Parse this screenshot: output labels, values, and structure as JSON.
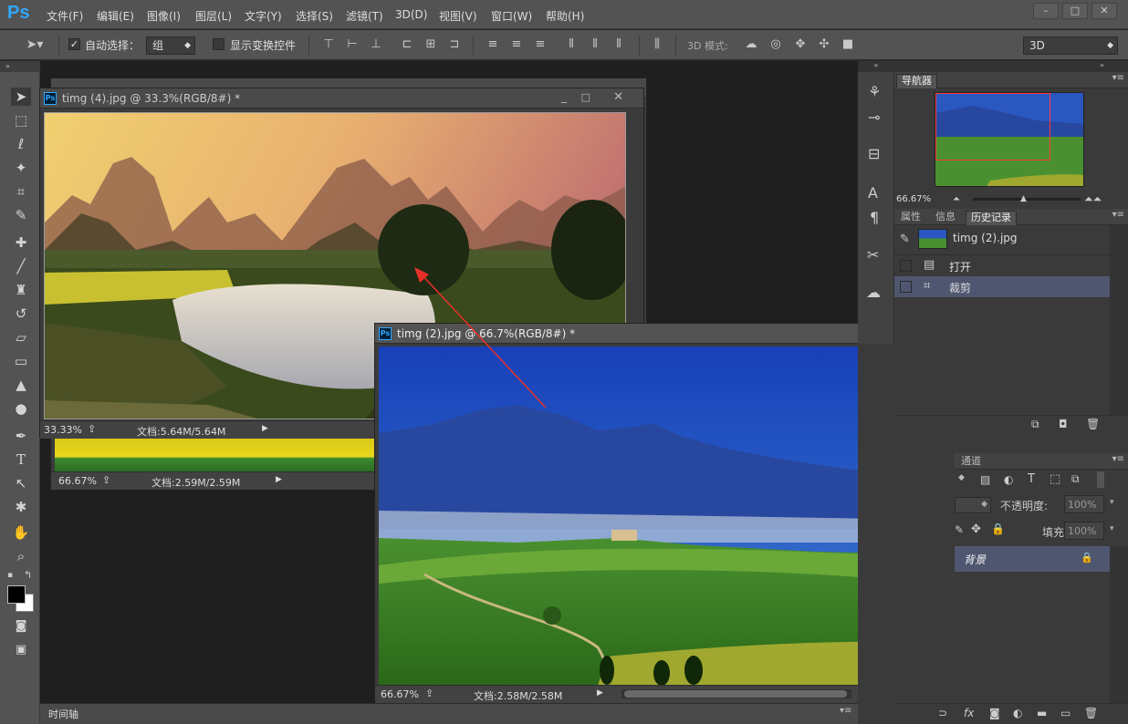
{
  "app": {
    "logo": "Ps"
  },
  "menu": [
    "文件(F)",
    "编辑(E)",
    "图像(I)",
    "图层(L)",
    "文字(Y)",
    "选择(S)",
    "滤镜(T)",
    "3D(D)",
    "视图(V)",
    "窗口(W)",
    "帮助(H)"
  ],
  "window_controls": {
    "minimize": "–",
    "maximize": "□",
    "close": "✕"
  },
  "options_bar": {
    "auto_select_label": "自动选择：",
    "auto_select_value": "组",
    "show_transform_label": "显示变换控件",
    "mode_3d_label": "3D 模式:",
    "workspace_value": "3D"
  },
  "documents": [
    {
      "title": "timg (4).jpg @ 33.3%(RGB/8#) *",
      "zoom": "33.33%",
      "doc_size": "文档:5.64M/5.64M"
    },
    {
      "title": "timg (2).jpg @ 66.7%(RGB/8#) *",
      "zoom": "66.67%",
      "doc_size": "文档:2.58M/2.58M"
    }
  ],
  "background_doc": {
    "zoom": "66.67%",
    "doc_size": "文档:2.59M/2.59M"
  },
  "navigator": {
    "tab": "导航器",
    "zoom": "66.67%"
  },
  "history_panel": {
    "tabs": [
      "属性",
      "信息",
      "历史记录"
    ],
    "snapshot_name": "timg (2).jpg",
    "items": [
      "打开",
      "裁剪"
    ]
  },
  "layers_panel": {
    "tab": "通道",
    "opacity_label": "不透明度:",
    "opacity_value": "100%",
    "fill_label": "填充:",
    "fill_value": "100%",
    "layer_name": "背景"
  },
  "timeline": {
    "label": "时间轴"
  },
  "colors": {
    "accent": "#31a8ff",
    "arrow": "#e8302a",
    "nav_box": "#ff3a3a"
  }
}
